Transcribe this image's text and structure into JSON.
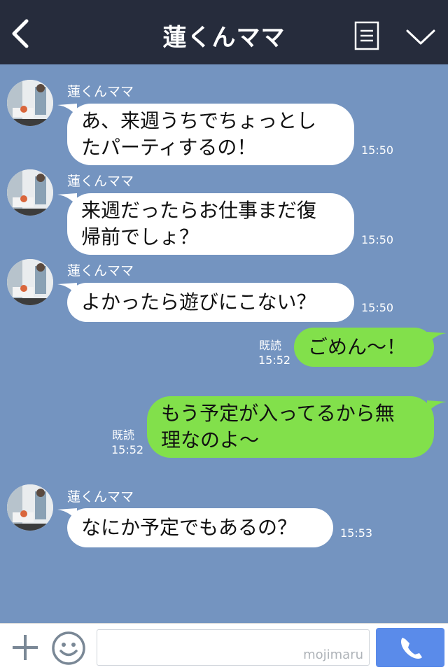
{
  "header": {
    "title": "蓮くんママ"
  },
  "messages": [
    {
      "sender": "蓮くんママ",
      "text": "あ、来週うちでちょっとし\nたパーティするの！",
      "time": "15:50"
    },
    {
      "sender": "蓮くんママ",
      "text": "来週だったらお仕事まだ復\n帰前でしょ？",
      "time": "15:50"
    },
    {
      "sender": "蓮くんママ",
      "text": "よかったら遊びにこない？",
      "time": "15:50"
    },
    {
      "read": "既読",
      "text": "ごめん～！",
      "time": "15:52"
    },
    {
      "read": "既読",
      "text": "もう予定が入ってるから無\n理なのよ～",
      "time": "15:52"
    },
    {
      "sender": "蓮くんママ",
      "text": "なにか予定でもあるの？",
      "time": "15:53"
    }
  ],
  "footer": {
    "input_value": "",
    "watermark": "mojimaru"
  },
  "colors": {
    "header_bg": "#262c3c",
    "chat_bg": "#7494c0",
    "incoming_bubble": "#ffffff",
    "outgoing_bubble": "#82e04b",
    "call_button": "#5a8bea"
  },
  "icons": [
    "back-arrow-icon",
    "menu-list-icon",
    "chevron-down-icon",
    "plus-icon",
    "smiley-icon",
    "phone-icon"
  ]
}
